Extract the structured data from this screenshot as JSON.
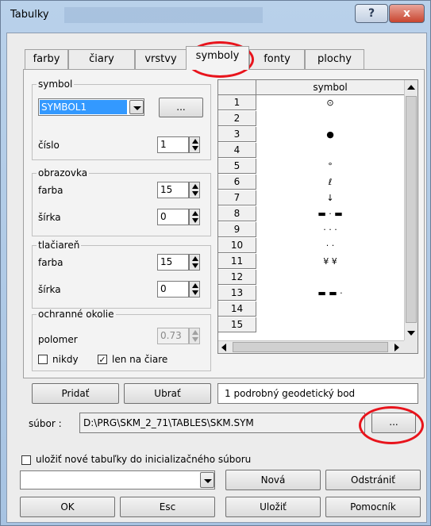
{
  "window": {
    "title": "Tabulky",
    "help": "?",
    "close": "x"
  },
  "tabs": [
    "farby",
    "čiary",
    "vrstvy",
    "symboly",
    "fonty",
    "plochy"
  ],
  "symbol": {
    "group": "symbol",
    "select": "SYMBOL1",
    "browse": "...",
    "cislo_label": "číslo",
    "cislo_value": "1"
  },
  "obrazovka": {
    "group": "obrazovka",
    "farba_label": "farba",
    "farba_value": "15",
    "sirka_label": "šírka",
    "sirka_value": "0"
  },
  "tlaciaren": {
    "group": "tlačiareň",
    "farba_label": "farba",
    "farba_value": "15",
    "sirka_label": "šírka",
    "sirka_value": "0"
  },
  "okolie": {
    "group": "ochranné okolie",
    "polomer_label": "polomer",
    "polomer_value": "0.73",
    "nikdy": "nikdy",
    "len": "len na čiare",
    "check_mark": "✓"
  },
  "grid": {
    "header": "symbol",
    "rows": [
      "1",
      "2",
      "3",
      "4",
      "5",
      "6",
      "7",
      "8",
      "9",
      "10",
      "11",
      "12",
      "13",
      "14",
      "15"
    ],
    "symbols": [
      "⊙",
      "",
      "●",
      "",
      "°",
      "ℓ",
      "↓",
      "▬ · ▬",
      "· · ·",
      "· ·",
      "¥          ¥",
      "",
      "▬ ▬ ·",
      "",
      ""
    ]
  },
  "buttons": {
    "add": "Pridať",
    "remove": "Ubrať",
    "description": "1 podrobný geodetický bod"
  },
  "subor": {
    "label": "súbor :",
    "path": "D:\\PRG\\SKM_2_71\\TABLES\\SKM.SYM",
    "browse": "..."
  },
  "save_checkbox": "uložiť nové tabuľky do inicializačného súboru",
  "bottom": {
    "combo_value": "",
    "new": "Nová",
    "delete": "Odstrániť",
    "ok": "OK",
    "esc": "Esc",
    "save": "Uložiť",
    "help": "Pomocník"
  },
  "colors": {
    "selection": "#3399ff",
    "annotation": "#e8141c"
  }
}
